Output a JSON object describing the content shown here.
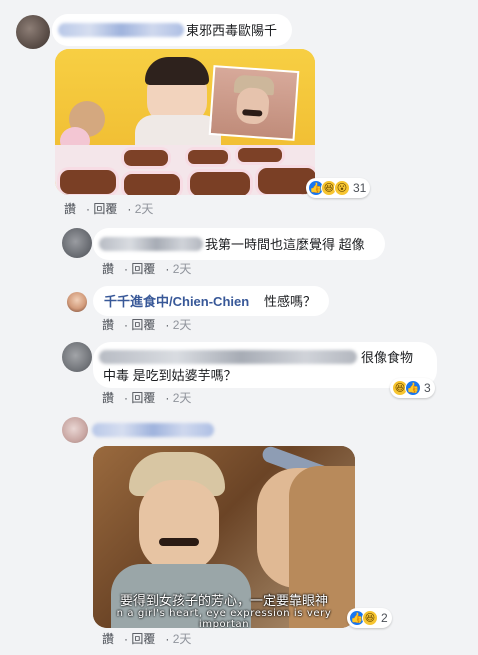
{
  "comments": [
    {
      "text": "東邪西毒歐陽千",
      "actions": {
        "like": "讚",
        "reply": "回覆",
        "time": "2天"
      },
      "reaction_count": "31"
    },
    {
      "text": "我第一時間也這麼覺得 超像",
      "actions": {
        "like": "讚",
        "reply": "回覆",
        "time": "2天"
      }
    },
    {
      "author": "千千進食中/Chien-Chien",
      "text": "性感嗎？",
      "actions": {
        "like": "讚",
        "reply": "回覆",
        "time": "2天"
      }
    },
    {
      "text_line1": "很像食物",
      "text_line2": "中毒 是吃到姑婆芋嗎？",
      "actions": {
        "like": "讚",
        "reply": "回覆",
        "time": "2天"
      },
      "reaction_count": "3"
    },
    {
      "subtitle_cn": "要得到女孩子的芳心，一定要靠眼神",
      "subtitle_en": "n a girl's heart, eye expression is very importan",
      "actions": {
        "like": "讚",
        "reply": "回覆",
        "time": "2天"
      },
      "reaction_count": "2"
    }
  ],
  "icons": {
    "like": "like-icon",
    "haha": "haha-icon",
    "wow": "wow-icon"
  },
  "colors": {
    "link": "#385898",
    "like": "#1877f2",
    "background": "#f2f3f5"
  }
}
